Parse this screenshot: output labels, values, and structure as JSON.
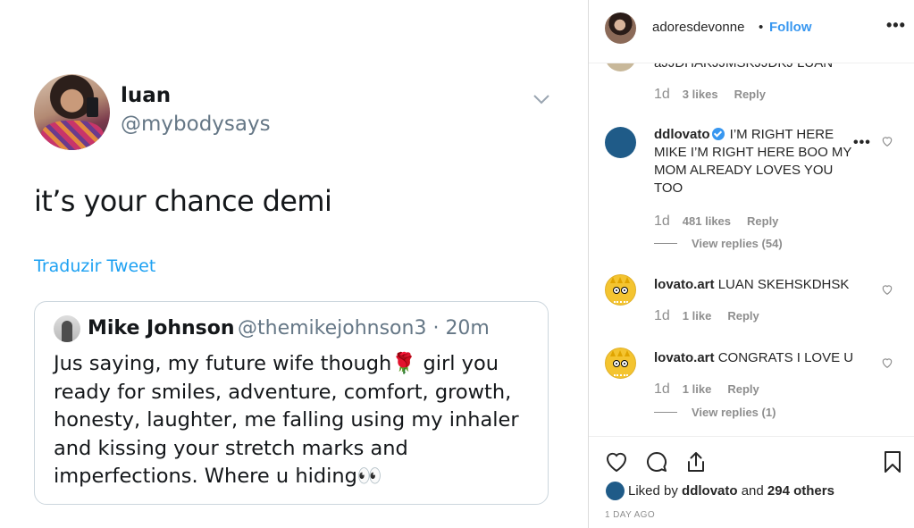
{
  "tweet": {
    "name": "luan",
    "handle": "@mybodysays",
    "text": "it’s your chance demi",
    "translate_label": "Traduzir Tweet",
    "quote": {
      "name": "Mike Johnson",
      "handle_time": "@themikejohnson3 · 20m",
      "body_before": "Jus saying, my future wife though",
      "rose_emoji": "🌹",
      "body_mid": " girl you ready for smiles, adventure, comfort, growth, honesty, laughter, me falling using my inhaler and kissing your stretch marks and imperfections. Where u hiding",
      "eyes_emoji": "👀"
    }
  },
  "post": {
    "header": {
      "username": "adoresdevonne",
      "dot": "•",
      "follow_label": "Follow",
      "more_label": "•••"
    },
    "comments": {
      "clipped": {
        "text": "aJJDHAKJJMSKJJDKJ LUAN",
        "age": "1d",
        "likes": "3 likes",
        "reply": "Reply"
      },
      "items": [
        {
          "user": "ddlovato",
          "verified": true,
          "text": "I’M RIGHT HERE MIKE I’M RIGHT HERE BOO MY MOM ALREADY LOVES YOU TOO",
          "age": "1d",
          "likes": "481 likes",
          "reply": "Reply",
          "view_replies": "View replies (54)"
        },
        {
          "user": "lovato.art",
          "text": "LUAN SKEHSKDHSK",
          "age": "1d",
          "likes": "1 like",
          "reply": "Reply"
        },
        {
          "user": "lovato.art",
          "text": "CONGRATS I LOVE U",
          "age": "1d",
          "likes": "1 like",
          "reply": "Reply",
          "view_replies": "View replies (1)"
        }
      ]
    },
    "actions": {
      "liked_by_prefix": "Liked by",
      "liked_by_user": "ddlovato",
      "liked_by_and": "and",
      "liked_by_others": "294 others",
      "age": "1 DAY AGO"
    }
  },
  "colors": {
    "follow": "#3897f0",
    "twitter_link": "#1da1f2",
    "muted": "#8e8e8e",
    "verified": "#3897f0"
  }
}
